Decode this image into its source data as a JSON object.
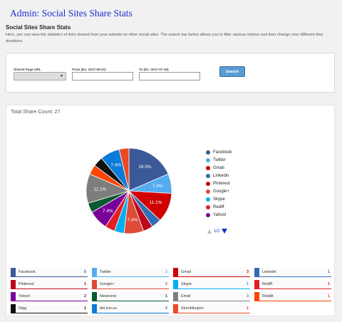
{
  "header": {
    "title": "Admin: Social Sites Share Stats",
    "section_title": "Social Sites Share Stats",
    "description": "Here, you can view the statistics of links shared from your website on other social sites. The search bar below allows you to filter various metrics and their change over different time durations."
  },
  "filters": {
    "page_url_label": "Shared Page URL",
    "from_label": "From (Ex: 2017-06-21)",
    "to_label": "To (Ex: 2017-07-30)",
    "page_url_value": "",
    "from_value": "",
    "to_value": "",
    "search_label": "Search"
  },
  "chart_panel": {
    "total_label": "Total Share Count: 27",
    "pager_text": "1/2"
  },
  "chart_data": {
    "type": "pie",
    "title": "",
    "slices": [
      {
        "label": "Facebook",
        "value": 5,
        "color": "#3b5998",
        "pct_label": "18.5%"
      },
      {
        "label": "Twitter",
        "value": 2,
        "color": "#55acee",
        "pct_label": "7.4%"
      },
      {
        "label": "Gmail",
        "value": 3,
        "color": "#d10000",
        "pct_label": "11.1%"
      },
      {
        "label": "Linkedin",
        "value": 1,
        "color": "#2f6db5",
        "pct_label": ""
      },
      {
        "label": "Pinterest",
        "value": 1,
        "color": "#bd081c",
        "pct_label": ""
      },
      {
        "label": "Google+",
        "value": 2,
        "color": "#dd4b39",
        "pct_label": "7.4%"
      },
      {
        "label": "Skype",
        "value": 1,
        "color": "#00aff0",
        "pct_label": ""
      },
      {
        "label": "Rediff",
        "value": 1,
        "color": "#e31e24",
        "pct_label": ""
      },
      {
        "label": "Yahoo!",
        "value": 2,
        "color": "#7b0099",
        "pct_label": "7.4%"
      },
      {
        "label": "Newsvine",
        "value": 1,
        "color": "#075b2f",
        "pct_label": ""
      },
      {
        "label": "Email",
        "value": 3,
        "color": "#7d7d7d",
        "pct_label": "11.1%"
      },
      {
        "label": "Reddit",
        "value": 1,
        "color": "#ff4500",
        "pct_label": ""
      },
      {
        "label": "Digg",
        "value": 1,
        "color": "#111111",
        "pct_label": ""
      },
      {
        "label": "del.icio.us",
        "value": 2,
        "color": "#0a7bd8",
        "pct_label": "7.4%"
      },
      {
        "label": "Stumbleupon",
        "value": 1,
        "color": "#eb4924",
        "pct_label": ""
      }
    ],
    "legend_visible": [
      "Facebook",
      "Twitter",
      "Gmail",
      "Linkedin",
      "Pinterest",
      "Google+",
      "Skype",
      "Rediff",
      "Yahoo!"
    ],
    "legend_placement": "right"
  },
  "stats": [
    {
      "name": "Facebook",
      "count": "5",
      "color": "#3b5998"
    },
    {
      "name": "Twitter",
      "count": "2",
      "color": "#55acee"
    },
    {
      "name": "Gmail",
      "count": "3",
      "color": "#d10000"
    },
    {
      "name": "Linkedin",
      "count": "1",
      "color": "#2f6db5"
    },
    {
      "name": "Pinterest",
      "count": "1",
      "color": "#bd081c"
    },
    {
      "name": "Google+",
      "count": "2",
      "color": "#dd4b39"
    },
    {
      "name": "Skype",
      "count": "1",
      "color": "#00aff0"
    },
    {
      "name": "Rediff",
      "count": "1",
      "color": "#e31e24"
    },
    {
      "name": "Yahoo!",
      "count": "2",
      "color": "#7b0099"
    },
    {
      "name": "Newsvine",
      "count": "1",
      "color": "#075b2f"
    },
    {
      "name": "Email",
      "count": "3",
      "color": "#7d7d7d"
    },
    {
      "name": "Reddit",
      "count": "1",
      "color": "#ff4500"
    },
    {
      "name": "Digg",
      "count": "1",
      "color": "#111111"
    },
    {
      "name": "del.icio.us",
      "count": "2",
      "color": "#0a7bd8"
    },
    {
      "name": "Stumbleupon",
      "count": "1",
      "color": "#eb4924"
    }
  ]
}
